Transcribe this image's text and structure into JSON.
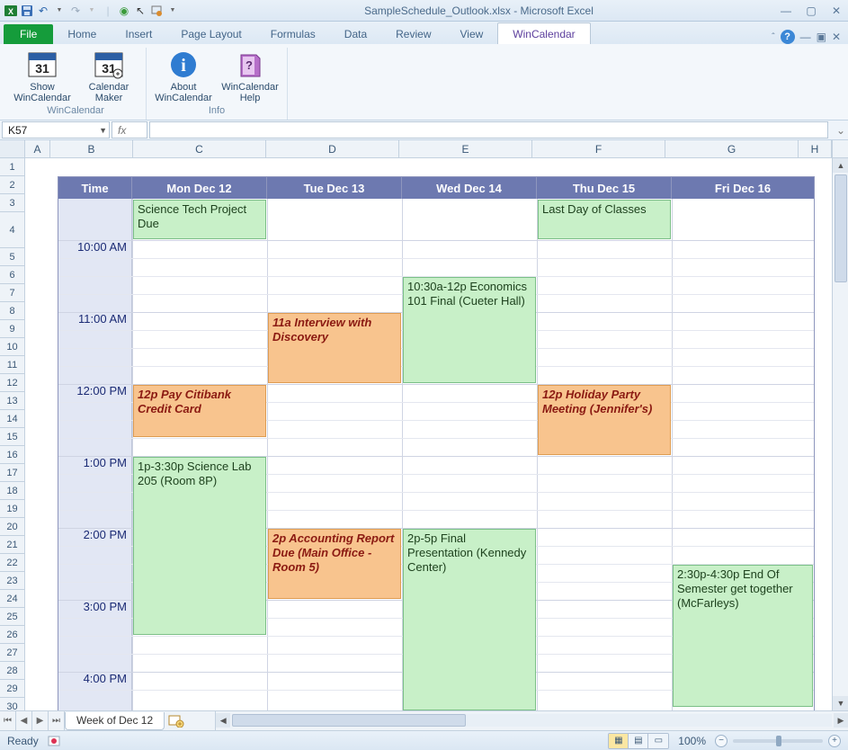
{
  "window": {
    "title": "SampleSchedule_Outlook.xlsx - Microsoft Excel"
  },
  "qat": {
    "save": "save-icon",
    "undo": "undo-icon",
    "redo": "redo-icon"
  },
  "tabs": {
    "file": "File",
    "items": [
      "Home",
      "Insert",
      "Page Layout",
      "Formulas",
      "Data",
      "Review",
      "View",
      "WinCalendar"
    ],
    "active": "WinCalendar"
  },
  "ribbon": {
    "group1": {
      "label": "WinCalendar",
      "buttons": [
        {
          "name": "show-wincalendar",
          "label": "Show WinCalendar"
        },
        {
          "name": "calendar-maker",
          "label": "Calendar Maker"
        }
      ]
    },
    "group2": {
      "label": "Info",
      "buttons": [
        {
          "name": "about-wincalendar",
          "label": "About WinCalendar"
        },
        {
          "name": "wincalendar-help",
          "label": "WinCalendar Help"
        }
      ]
    }
  },
  "namebox": "K57",
  "fx_label": "fx",
  "columns": [
    "A",
    "B",
    "C",
    "D",
    "E",
    "F",
    "G",
    "H"
  ],
  "row_headers": [
    "1",
    "2",
    "3",
    "4",
    "5",
    "6",
    "7",
    "8",
    "9",
    "10",
    "11",
    "12",
    "13",
    "14",
    "15",
    "16",
    "17",
    "18",
    "19",
    "20",
    "21",
    "22",
    "23",
    "24",
    "25",
    "26",
    "27",
    "28",
    "29",
    "30"
  ],
  "calendar": {
    "header": {
      "time": "Time",
      "days": [
        "Mon Dec 12",
        "Tue Dec 13",
        "Wed Dec 14",
        "Thu Dec 15",
        "Fri Dec 16"
      ]
    },
    "time_labels": [
      "10:00 AM",
      "11:00 AM",
      "12:00 PM",
      "1:00 PM",
      "2:00 PM",
      "3:00 PM",
      "4:00 PM"
    ],
    "allday": {
      "mon": "Science Tech Project Due",
      "thu": "Last Day of Classes"
    },
    "events": {
      "mon_12p": "12p Pay Citibank Credit Card",
      "mon_1p": "1p-3:30p Science Lab 205 (Room 8P)",
      "tue_11a": "11a Interview with Discovery",
      "tue_2p": "2p Accounting Report Due (Main Office - Room 5)",
      "wed_1030": "10:30a-12p Economics 101 Final (Cueter Hall)",
      "wed_2p": "2p-5p Final Presentation (Kennedy Center)",
      "thu_12p": "12p Holiday Party Meeting (Jennifer's)",
      "fri_230": "2:30p-4:30p End Of Semester get together (McFarleys)"
    }
  },
  "sheet_tab": "Week of Dec 12",
  "status": {
    "ready": "Ready",
    "zoom": "100%"
  }
}
